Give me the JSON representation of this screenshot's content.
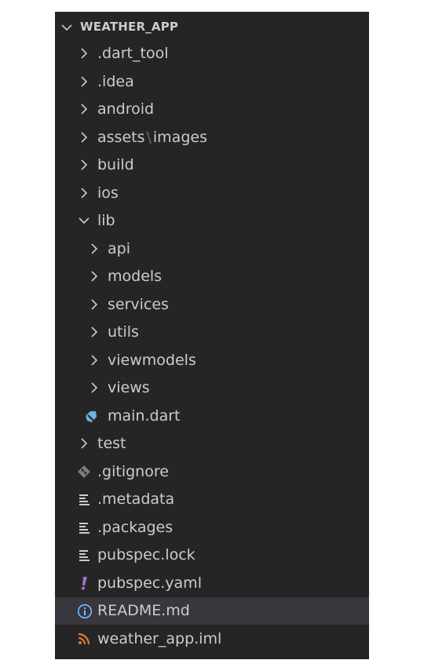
{
  "explorer": {
    "root_title": "WEATHER_APP",
    "root_expanded": true,
    "items": [
      {
        "label": ".dart_tool",
        "kind": "folder",
        "expanded": false,
        "depth": 0,
        "icon": "chevron-right-icon"
      },
      {
        "label": ".idea",
        "kind": "folder",
        "expanded": false,
        "depth": 0,
        "icon": "chevron-right-icon"
      },
      {
        "label": "android",
        "kind": "folder",
        "expanded": false,
        "depth": 0,
        "icon": "chevron-right-icon"
      },
      {
        "label_parts": [
          "assets",
          "\\",
          "images"
        ],
        "kind": "folder",
        "expanded": false,
        "depth": 0,
        "icon": "chevron-right-icon"
      },
      {
        "label": "build",
        "kind": "folder",
        "expanded": false,
        "depth": 0,
        "icon": "chevron-right-icon"
      },
      {
        "label": "ios",
        "kind": "folder",
        "expanded": false,
        "depth": 0,
        "icon": "chevron-right-icon"
      },
      {
        "label": "lib",
        "kind": "folder",
        "expanded": true,
        "depth": 0,
        "icon": "chevron-down-icon"
      },
      {
        "label": "api",
        "kind": "folder",
        "expanded": false,
        "depth": 1,
        "icon": "chevron-right-icon"
      },
      {
        "label": "models",
        "kind": "folder",
        "expanded": false,
        "depth": 1,
        "icon": "chevron-right-icon"
      },
      {
        "label": "services",
        "kind": "folder",
        "expanded": false,
        "depth": 1,
        "icon": "chevron-right-icon"
      },
      {
        "label": "utils",
        "kind": "folder",
        "expanded": false,
        "depth": 1,
        "icon": "chevron-right-icon"
      },
      {
        "label": "viewmodels",
        "kind": "folder",
        "expanded": false,
        "depth": 1,
        "icon": "chevron-right-icon"
      },
      {
        "label": "views",
        "kind": "folder",
        "expanded": false,
        "depth": 1,
        "icon": "chevron-right-icon"
      },
      {
        "label": "main.dart",
        "kind": "file",
        "depth": 1,
        "icon": "dart-file-icon"
      },
      {
        "label": "test",
        "kind": "folder",
        "expanded": false,
        "depth": 0,
        "icon": "chevron-right-icon"
      },
      {
        "label": ".gitignore",
        "kind": "file",
        "depth": 0,
        "icon": "git-file-icon"
      },
      {
        "label": ".metadata",
        "kind": "file",
        "depth": 0,
        "icon": "text-lines-icon"
      },
      {
        "label": ".packages",
        "kind": "file",
        "depth": 0,
        "icon": "text-lines-icon"
      },
      {
        "label": "pubspec.lock",
        "kind": "file",
        "depth": 0,
        "icon": "text-lines-icon"
      },
      {
        "label": "pubspec.yaml",
        "kind": "file",
        "depth": 0,
        "icon": "yaml-exclamation-icon"
      },
      {
        "label": "README.md",
        "kind": "file",
        "depth": 0,
        "icon": "info-icon",
        "selected": true
      },
      {
        "label": "weather_app.iml",
        "kind": "file",
        "depth": 0,
        "icon": "rss-feed-icon"
      }
    ]
  },
  "colors": {
    "panel_background": "#252526",
    "text": "#cccccc",
    "selected_row": "#37373d",
    "dart_icon": "#6cb2df",
    "git_icon": "#7d7d7d",
    "yaml_icon": "#a074c4",
    "info_icon": "#75beff",
    "rss_icon": "#e37933"
  }
}
